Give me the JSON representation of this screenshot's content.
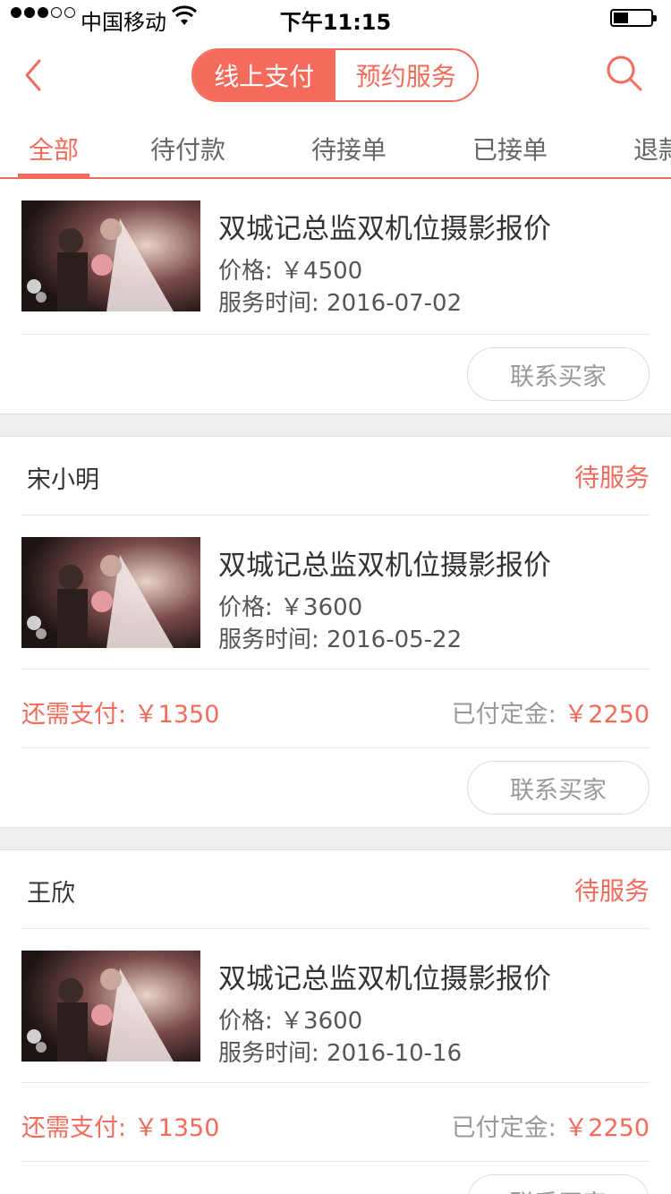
{
  "status_bar": {
    "carrier": "中国移动",
    "time": "下午11:15"
  },
  "nav": {
    "segment_online": "线上支付",
    "segment_booking": "预约服务"
  },
  "tabs": [
    "全部",
    "待付款",
    "待接单",
    "已接单",
    "退款"
  ],
  "orders": [
    {
      "title": "双城记总监双机位摄影报价",
      "price": "价格: ￥4500",
      "service_time": "服务时间: 2016-07-02",
      "contact": "联系买家"
    },
    {
      "buyer": "宋小明",
      "status": "待服务",
      "title": "双城记总监双机位摄影报价",
      "price": "价格: ￥3600",
      "service_time": "服务时间: 2016-05-22",
      "need_pay": "还需支付: ￥1350",
      "paid_label": "已付定金: ",
      "paid_amount": "￥2250",
      "contact": "联系买家"
    },
    {
      "buyer": "王欣",
      "status": "待服务",
      "title": "双城记总监双机位摄影报价",
      "price": "价格: ￥3600",
      "service_time": "服务时间: 2016-10-16",
      "need_pay": "还需支付: ￥1350",
      "paid_label": "已付定金: ",
      "paid_amount": "￥2250",
      "contact": "联系买家"
    }
  ],
  "colors": {
    "accent": "#f46b5b",
    "divider": "#e6e6e6",
    "gap_bg": "#efefef"
  }
}
